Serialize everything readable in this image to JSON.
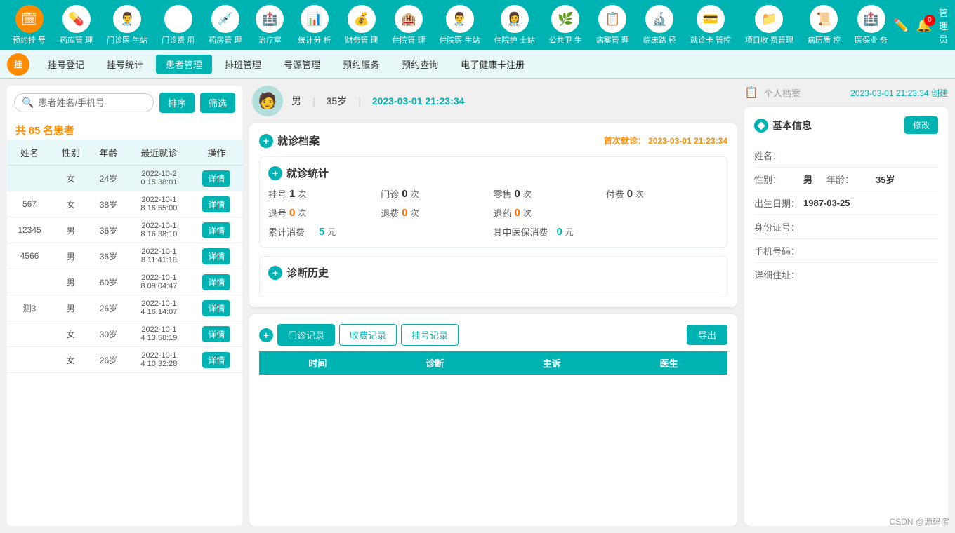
{
  "topNav": {
    "items": [
      {
        "id": "appt",
        "icon": "📅",
        "label": "预约挂\n号",
        "isOrange": true
      },
      {
        "id": "pharmacy",
        "icon": "💊",
        "label": "药库管\n理"
      },
      {
        "id": "outpatient",
        "icon": "👨‍⚕️",
        "label": "门诊医\n生站"
      },
      {
        "id": "outpatient-fee",
        "icon": "¥",
        "label": "门诊费\n用"
      },
      {
        "id": "pharma-mgmt",
        "icon": "💉",
        "label": "药房管\n理"
      },
      {
        "id": "treatment",
        "icon": "🏥",
        "label": "治疗室"
      },
      {
        "id": "stats",
        "icon": "📊",
        "label": "统计分\n析"
      },
      {
        "id": "finance",
        "icon": "💰",
        "label": "财务管\n理"
      },
      {
        "id": "inpatient-mgmt",
        "icon": "🏨",
        "label": "住院管\n理"
      },
      {
        "id": "inpatient-doc",
        "icon": "👨‍⚕️",
        "label": "住院医\n生站"
      },
      {
        "id": "inpatient-nurse",
        "icon": "👩‍⚕️",
        "label": "住院护\n士站"
      },
      {
        "id": "public-health",
        "icon": "🌿",
        "label": "公共卫\n生"
      },
      {
        "id": "case-mgmt",
        "icon": "📋",
        "label": "病案管\n理"
      },
      {
        "id": "clinical",
        "icon": "🔬",
        "label": "临床路\n径"
      },
      {
        "id": "card",
        "icon": "💳",
        "label": "就诊卡\n管控"
      },
      {
        "id": "project",
        "icon": "📁",
        "label": "项目收\n费管理"
      },
      {
        "id": "history",
        "icon": "📜",
        "label": "病历质\n控"
      },
      {
        "id": "medical",
        "icon": "🏥",
        "label": "医保业\n务"
      }
    ],
    "adminLabel": "管理员"
  },
  "secondNav": {
    "tabs": [
      {
        "id": "register",
        "label": "挂号登记"
      },
      {
        "id": "stats",
        "label": "挂号统计"
      },
      {
        "id": "patients",
        "label": "患者管理",
        "active": true
      },
      {
        "id": "schedule",
        "label": "排班管理"
      },
      {
        "id": "source",
        "label": "号源管理"
      },
      {
        "id": "appointment",
        "label": "预约服务"
      },
      {
        "id": "appt-query",
        "label": "预约查询"
      },
      {
        "id": "health-card",
        "label": "电子健康卡注册"
      }
    ]
  },
  "leftPanel": {
    "searchPlaceholder": "患者姓名/手机号",
    "sortLabel": "排序",
    "filterLabel": "筛选",
    "countPrefix": "共",
    "countNum": "85",
    "countSuffix": "名患者",
    "tableHeaders": [
      "姓名",
      "性别",
      "年龄",
      "最近就诊",
      "操作"
    ],
    "patients": [
      {
        "name": "",
        "gender": "女",
        "age": "24岁",
        "lastVisit": "2022-10-2\n0 15:38:01",
        "detail": "详情"
      },
      {
        "name": "567",
        "gender": "女",
        "age": "38岁",
        "lastVisit": "2022-10-1\n8 16:55:00",
        "detail": "详情"
      },
      {
        "name": "12345",
        "gender": "男",
        "age": "36岁",
        "lastVisit": "2022-10-1\n8 16:38:10",
        "detail": "详情"
      },
      {
        "name": "4566",
        "gender": "男",
        "age": "36岁",
        "lastVisit": "2022-10-1\n8 11:41:18",
        "detail": "详情"
      },
      {
        "name": "",
        "gender": "男",
        "age": "60岁",
        "lastVisit": "2022-10-1\n8 09:04:47",
        "detail": "详情"
      },
      {
        "name": "测3",
        "gender": "男",
        "age": "26岁",
        "lastVisit": "2022-10-1\n4 16:14:07",
        "detail": "详情"
      },
      {
        "name": "",
        "gender": "女",
        "age": "30岁",
        "lastVisit": "2022-10-1\n4 13:58:19",
        "detail": "详情"
      },
      {
        "name": "",
        "gender": "女",
        "age": "26岁",
        "lastVisit": "2022-10-1\n4 10:32:28",
        "detail": "详情"
      }
    ]
  },
  "patientHeader": {
    "gender": "男",
    "age": "35岁",
    "datetime": "2023-03-01 21:23:34"
  },
  "visitRecord": {
    "title": "就诊档案",
    "firstVisitLabel": "首次就诊：",
    "firstVisitDate": "2023-03-01 21:23:34",
    "statsTitle": "就诊统计",
    "stats": [
      {
        "label": "挂号",
        "value": "1",
        "unit": "次",
        "color": "normal"
      },
      {
        "label": "门诊",
        "value": "0",
        "unit": "次",
        "color": "normal"
      },
      {
        "label": "零售",
        "value": "0",
        "unit": "次",
        "color": "normal"
      },
      {
        "label": "付费",
        "value": "0",
        "unit": "次",
        "color": "normal"
      },
      {
        "label": "退号",
        "value": "0",
        "unit": "次",
        "color": "orange"
      },
      {
        "label": "退费",
        "value": "0",
        "unit": "次",
        "color": "orange"
      },
      {
        "label": "退药",
        "value": "0",
        "unit": "次",
        "color": "orange"
      },
      {
        "label": "",
        "value": "",
        "unit": "",
        "color": "normal"
      },
      {
        "label": "累计消费",
        "value": "5",
        "unit": "元",
        "color": "teal"
      },
      {
        "label": "其中医保消费",
        "value": "0",
        "unit": "元",
        "color": "teal"
      }
    ],
    "diagTitle": "诊断历史",
    "tabs": [
      "门诊记录",
      "收费记录",
      "挂号记录"
    ],
    "activeTab": "门诊记录",
    "exportLabel": "导出",
    "tableHeaders": [
      "时间",
      "诊断",
      "主诉",
      "医生"
    ]
  },
  "personalRecord": {
    "title": "个人档案",
    "createdDate": "2023-03-01 21:23:34 创建",
    "basicInfoTitle": "基本信息",
    "editLabel": "修改",
    "fields": [
      {
        "label": "姓名：",
        "value": ""
      },
      {
        "label": "性别：",
        "value": "男",
        "bold": true
      },
      {
        "label": "年龄：",
        "value": "35岁",
        "bold": true
      },
      {
        "label": "出生日期：",
        "value": "1987-03-25",
        "bold": true
      },
      {
        "label": "身份证号：",
        "value": ""
      },
      {
        "label": "手机号码：",
        "value": ""
      },
      {
        "label": "详细住址：",
        "value": ""
      }
    ]
  },
  "watermark": "CSDN @源码宝"
}
